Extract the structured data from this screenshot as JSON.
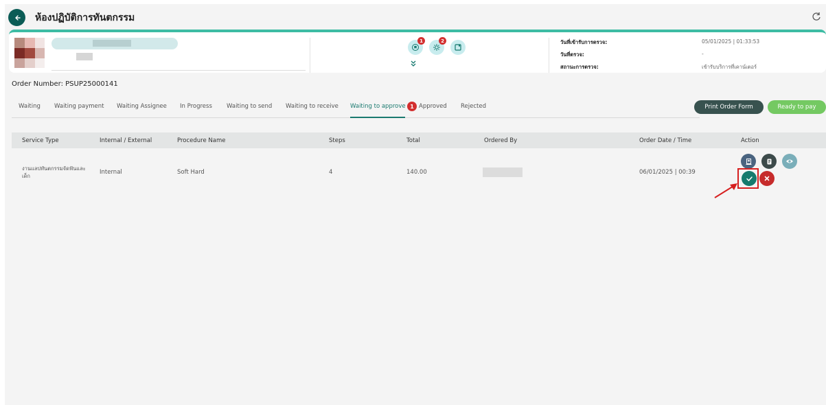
{
  "header": {
    "title": "ห้องปฏิบัติการทันตกรรม"
  },
  "patient_card": {
    "icon_badges": [
      "1",
      "2"
    ],
    "info": [
      {
        "label": "วันที่เข้ารับการตรวจ:",
        "value": "05/01/2025 | 01:33:53"
      },
      {
        "label": "วันที่ตรวจ:",
        "value": "-"
      },
      {
        "label": "สถานะการตรวจ:",
        "value": "เข้ารับบริการที่เคาน์เตอร์"
      }
    ]
  },
  "order": {
    "number_text": "Order Number: PSUP25000141"
  },
  "tabs": [
    {
      "label": "Waiting"
    },
    {
      "label": "Waiting payment"
    },
    {
      "label": "Waiting Assignee"
    },
    {
      "label": "In Progress"
    },
    {
      "label": "Waiting to send"
    },
    {
      "label": "Waiting to receive"
    },
    {
      "label": "Waiting to approve",
      "badge": "1",
      "active": true
    },
    {
      "label": "Approved"
    },
    {
      "label": "Rejected"
    }
  ],
  "buttons": {
    "print_order_form": "Print Order Form",
    "ready_to_pay": "Ready to pay"
  },
  "table": {
    "columns": [
      "Service Type",
      "Internal / External",
      "Procedure Name",
      "Steps",
      "Total",
      "Ordered By",
      "Order Date / Time",
      "Action"
    ],
    "rows": [
      {
        "service_type_line1": "งานแลปทันตกรรมจัดฟันและ",
        "service_type_line2": "เด็ก",
        "internal_external": "Internal",
        "procedure_name": "Soft Hard",
        "steps": "4",
        "total": "140.00",
        "order_datetime": "06/01/2025 | 00:39"
      }
    ]
  },
  "colors": {
    "primary": "#0b5c56",
    "accent": "#3dbca4",
    "active_tab": "#1a7a6f",
    "danger": "#d32f2f",
    "success": "#74c962",
    "dark_button": "#38524f"
  },
  "icons": [
    "back-arrow-icon",
    "refresh-icon",
    "tooth-icon",
    "gear-icon",
    "document-icon",
    "double-chevron-down-icon",
    "receipt-icon",
    "note-icon",
    "eye-icon",
    "check-icon",
    "close-icon"
  ]
}
